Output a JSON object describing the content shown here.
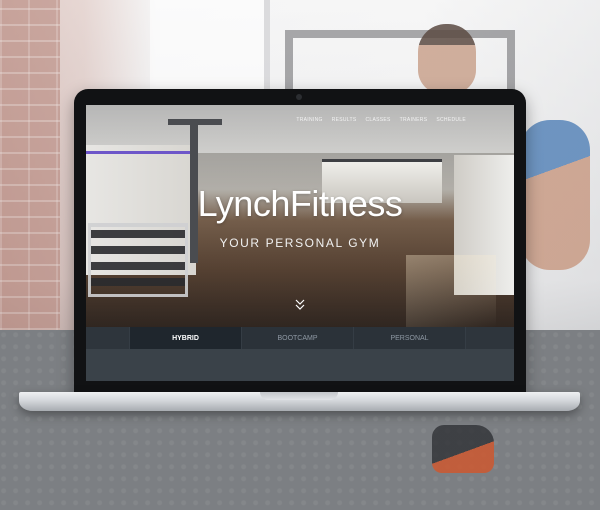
{
  "site": {
    "nav": [
      "TRAINING",
      "RESULTS",
      "CLASSES",
      "TRAINERS",
      "SCHEDULE"
    ],
    "brand": "LynchFitness",
    "tagline": "YOUR PERSONAL GYM",
    "scroll_icon": "double-chevron-down-icon",
    "tabs": [
      {
        "label": "HYBRID",
        "active": true
      },
      {
        "label": "BOOTCAMP",
        "active": false
      },
      {
        "label": "PERSONAL",
        "active": false
      }
    ]
  },
  "colors": {
    "tab_bar": "#2b3239",
    "tab_active": "#1f262d",
    "accent_purple": "#6d56c9"
  }
}
